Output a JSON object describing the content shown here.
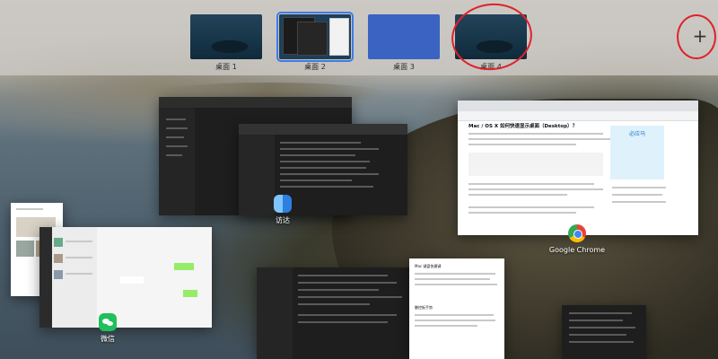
{
  "spaces": [
    {
      "label": "桌面 1"
    },
    {
      "label": "桌面 2"
    },
    {
      "label": "桌面 3"
    },
    {
      "label": "桌面 4"
    }
  ],
  "add_space": {
    "glyph": "+"
  },
  "apps": {
    "finder_label": "访达",
    "chrome_label": "Google Chrome",
    "wechat_label": "微信"
  },
  "chrome_page": {
    "title": "Mac / OS X 如何快速显示桌面（Desktop）？",
    "ad_text": "必应马"
  },
  "doc_window": {
    "heading1": "Mac 键盘快捷键",
    "heading2": "触控板手势"
  },
  "colors": {
    "accent_blue": "#3f7be6",
    "annotation_red": "#e0222a",
    "wechat_green": "#20c05c"
  }
}
